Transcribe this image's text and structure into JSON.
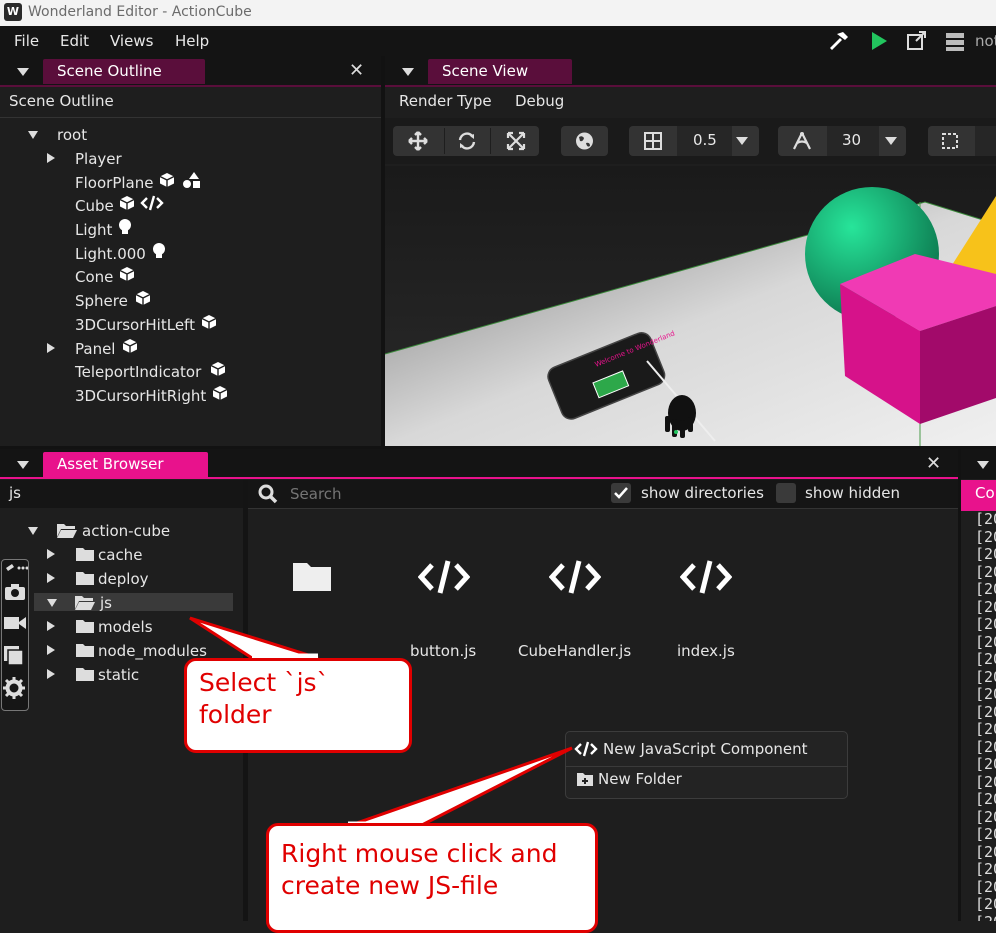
{
  "window": {
    "title": "Wonderland Editor - ActionCube",
    "logo": "W"
  },
  "menu": {
    "file": "File",
    "edit": "Edit",
    "views": "Views",
    "help": "Help",
    "right_text": "not"
  },
  "toolbar_icons": [
    "hammer-icon",
    "play-icon",
    "external-link-icon",
    "server-icon"
  ],
  "colors": {
    "accent": "#e8128c",
    "tab_inactive": "#5a0e3b",
    "play": "#22c55e",
    "callout_red": "#e00000"
  },
  "scene_outline": {
    "tab": "Scene Outline",
    "header": "Scene Outline",
    "root": "root",
    "items": [
      {
        "label": "Player",
        "icons": []
      },
      {
        "label": "FloorPlane",
        "icons": [
          "cube-icon",
          "shapes-icon"
        ]
      },
      {
        "label": "Cube",
        "icons": [
          "cube-icon",
          "code-icon"
        ]
      },
      {
        "label": "Light",
        "icons": [
          "lightbulb-icon"
        ]
      },
      {
        "label": "Light.000",
        "icons": [
          "lightbulb-icon"
        ]
      },
      {
        "label": "Cone",
        "icons": [
          "cube-icon"
        ]
      },
      {
        "label": "Sphere",
        "icons": [
          "cube-icon"
        ]
      },
      {
        "label": "3DCursorHitLeft",
        "icons": [
          "cube-icon"
        ]
      },
      {
        "label": "Panel",
        "icons": [
          "cube-icon"
        ]
      },
      {
        "label": "TeleportIndicator",
        "icons": [
          "cube-icon"
        ]
      },
      {
        "label": "3DCursorHitRight",
        "icons": [
          "cube-icon"
        ]
      }
    ]
  },
  "scene_view": {
    "tab": "Scene View",
    "render_type": "Render Type",
    "debug": "Debug",
    "grid_value": "0.5",
    "angle_value": "30",
    "panel_text": "Welcome to Wonderland"
  },
  "asset_browser": {
    "tab": "Asset Browser",
    "path": "js",
    "search_placeholder": "Search",
    "show_directories": "show directories",
    "show_directories_checked": true,
    "show_hidden": "show hidden",
    "show_hidden_checked": false,
    "tree_root": "action-cube",
    "tree": [
      "cache",
      "deploy",
      "js",
      "models",
      "node_modules",
      "static"
    ],
    "selected": "js",
    "files": [
      "",
      "button.js",
      "CubeHandler.js",
      "index.js"
    ]
  },
  "context_menu": {
    "new_component": "New JavaScript Component",
    "new_folder": "New Folder"
  },
  "callouts": {
    "select_line1": "Select `js`",
    "select_line2": "folder",
    "right_line1": "Right mouse click and",
    "right_line2": "create new JS-file"
  },
  "console": {
    "tab": "Co",
    "line_prefix": "[20"
  }
}
